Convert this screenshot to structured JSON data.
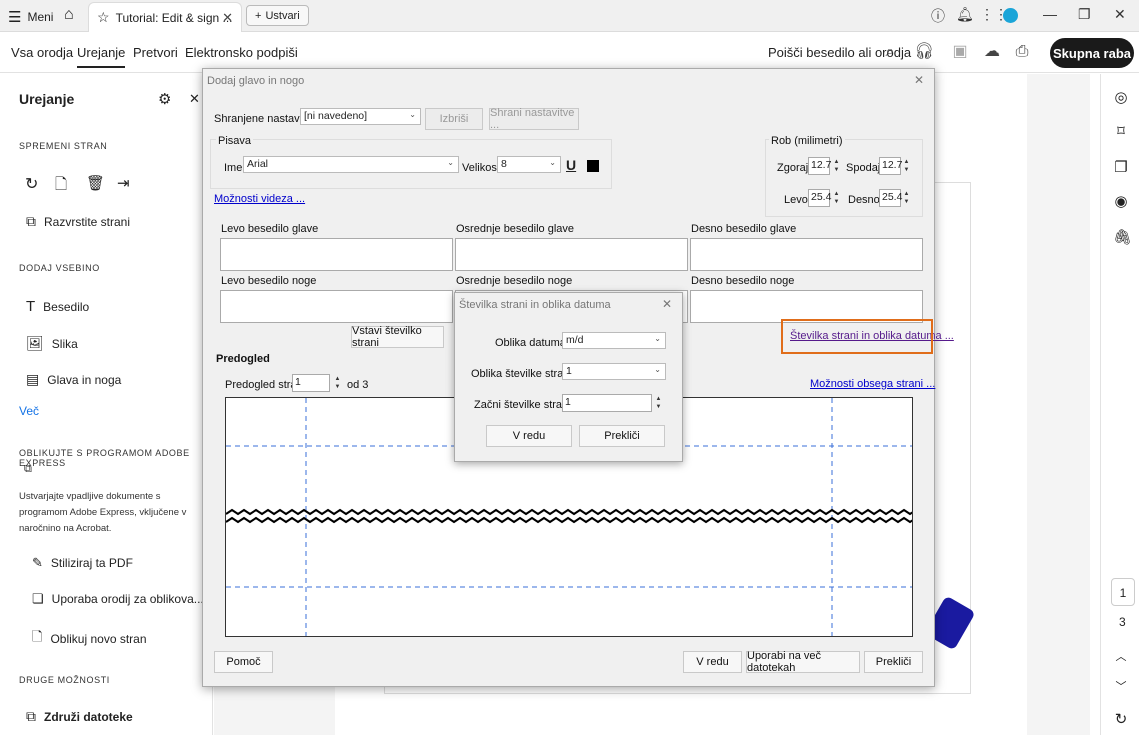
{
  "topbar": {
    "menu_label": "Meni",
    "tab_title": "Tutorial: Edit & sign ...",
    "new_tab_label": "Ustvari"
  },
  "toolbar": {
    "nav": [
      "Vsa orodja",
      "Urejanje",
      "Pretvori",
      "Elektronsko podpiši"
    ],
    "search_label": "Poišči besedilo ali orodja",
    "share_label": "Skupna raba"
  },
  "left_panel": {
    "title": "Urejanje",
    "sect_modify": "SPREMENI STRAN",
    "organize": "Razvrstite strani",
    "sect_add": "DODAJ VSEBINO",
    "text": "Besedilo",
    "image": "Slika",
    "header_footer": "Glava in noga",
    "more": "Več",
    "sect_express": "OBLIKUJTE S PROGRAMOM ADOBE EXPRESS",
    "express_desc": "Ustvarjajte vpadljive dokumente s programom Adobe Express, vključene v naročnino na Acrobat.",
    "stylize": "Stiliziraj ta PDF",
    "use_tools": "Uporaba orodij za oblikova...",
    "design_page": "Oblikuj novo stran",
    "sect_other": "DRUGE MOŽNOSTI",
    "combine": "Združi datoteke"
  },
  "right_rail": {
    "page_current": "1",
    "page_total": "3"
  },
  "dialog": {
    "title": "Dodaj glavo in nogo",
    "saved_settings_label": "Shranjene nastavitve:",
    "saved_settings_value": "[ni navedeno]",
    "delete": "Izbriši",
    "save_settings": "Shrani nastavitve ...",
    "font_group": "Pisava",
    "name_label": "Ime:",
    "font_name": "Arial",
    "size_label": "Velikost:",
    "font_size": "8",
    "margin_group": "Rob (milimetri)",
    "top_label": "Zgoraj:",
    "top_value": "12.7",
    "bottom_label": "Spodaj:",
    "bottom_value": "12.7",
    "left_label": "Levo:",
    "left_value": "25.4",
    "right_label": "Desno:",
    "right_value": "25.4",
    "appearance_link": "Možnosti videza ...",
    "left_header": "Levo besedilo glave",
    "center_header": "Osrednje besedilo glave",
    "right_header": "Desno besedilo glave",
    "left_footer": "Levo besedilo noge",
    "center_footer": "Osrednje besedilo noge",
    "right_footer": "Desno besedilo noge",
    "insert_page_number": "Vstavi številko strani",
    "page_date_link": "Številka strani in oblika datuma ...",
    "preview_label": "Predogled",
    "preview_page_label": "Predogled strani",
    "preview_page_value": "1",
    "preview_of": "od 3",
    "range_link": "Možnosti obsega strani ...",
    "help": "Pomoč",
    "ok": "V redu",
    "apply_multiple": "Uporabi na več datotekah",
    "cancel": "Prekliči"
  },
  "subdialog": {
    "title": "Številka strani in oblika datuma",
    "date_format_label": "Oblika datuma:",
    "date_format_value": "m/d",
    "page_format_label": "Oblika številke strani:",
    "page_format_value": "1",
    "start_label": "Začni številke strani:",
    "start_value": "1",
    "ok": "V redu",
    "cancel": "Prekliči"
  }
}
